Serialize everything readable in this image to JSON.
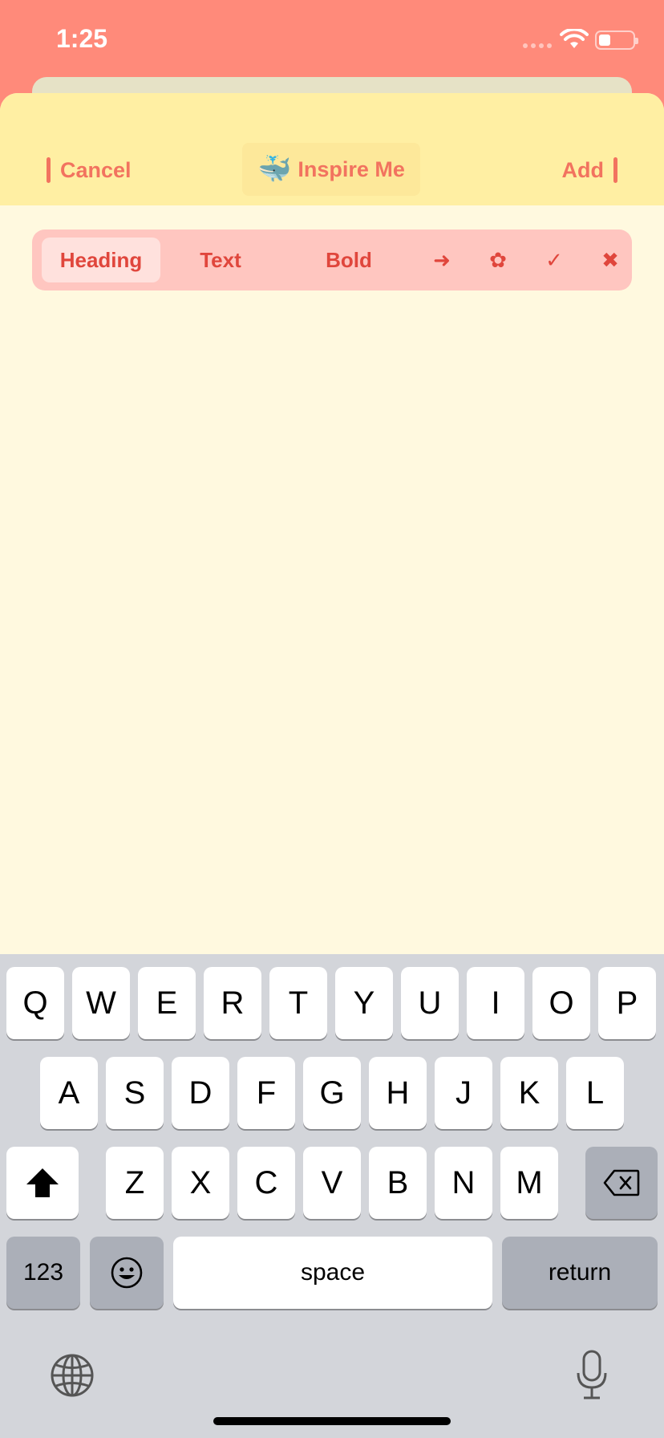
{
  "status": {
    "time": "1:25"
  },
  "header": {
    "cancel_label": "Cancel",
    "inspire_emoji": "🐳",
    "inspire_label": "Inspire Me",
    "add_label": "Add"
  },
  "format_bar": {
    "heading": "Heading",
    "text": "Text",
    "bold": "Bold",
    "arrow": "➜",
    "flower": "✿",
    "check": "✓",
    "cross": "✖"
  },
  "keyboard": {
    "row1": [
      "Q",
      "W",
      "E",
      "R",
      "T",
      "Y",
      "U",
      "I",
      "O",
      "P"
    ],
    "row2": [
      "A",
      "S",
      "D",
      "F",
      "G",
      "H",
      "J",
      "K",
      "L"
    ],
    "row3": [
      "Z",
      "X",
      "C",
      "V",
      "B",
      "N",
      "M"
    ],
    "numbers_label": "123",
    "emoji_label": "☺",
    "space_label": "space",
    "return_label": "return"
  },
  "colors": {
    "accent": "#F2735F",
    "header_bg": "#FFEFA3",
    "sheet_bg": "#FFF9DF",
    "toolbar_bg": "#FFC6C0"
  }
}
